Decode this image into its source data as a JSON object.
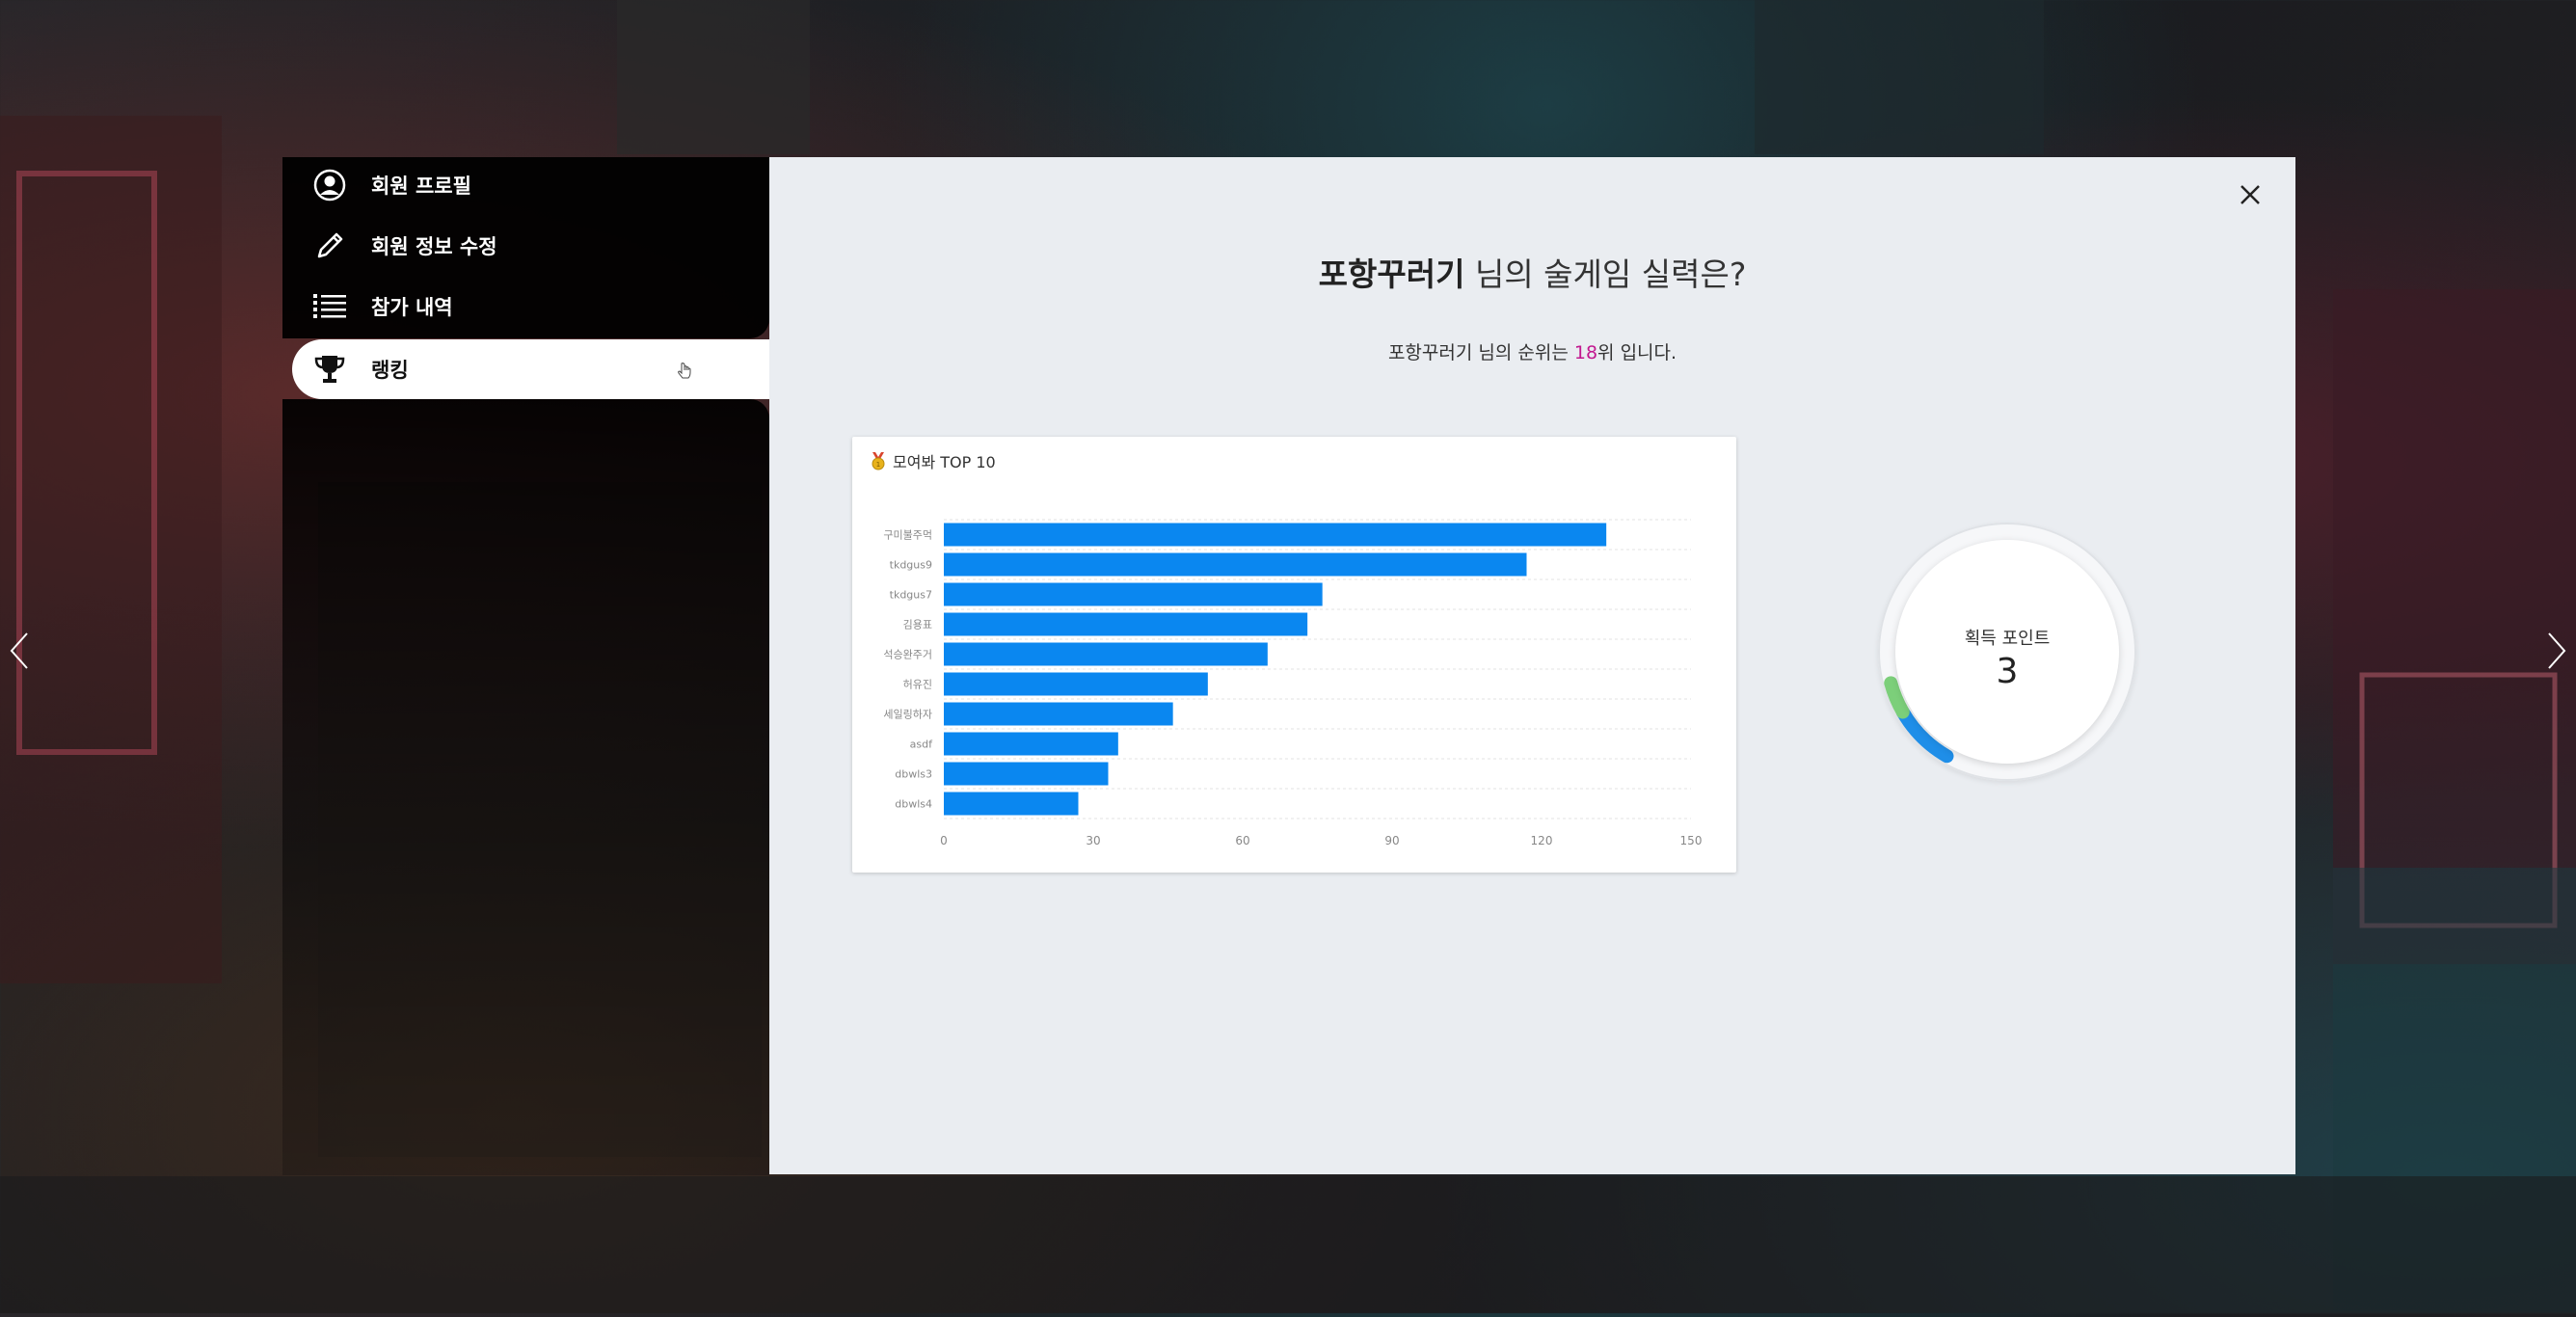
{
  "sidebar": {
    "items": [
      {
        "label": "회원 프로필",
        "icon": "user-circle-icon"
      },
      {
        "label": "회원 정보 수정",
        "icon": "pencil-icon"
      },
      {
        "label": "참가 내역",
        "icon": "list-icon"
      },
      {
        "label": "랭킹",
        "icon": "trophy-icon",
        "active": true
      }
    ]
  },
  "modal": {
    "title_name": "포항꾸러기",
    "title_rest": " 님의 술게임 실력은?",
    "subtitle_pre": "포항꾸러기 님의 순위는 ",
    "subtitle_rank": "18",
    "subtitle_post": "위 입니다.",
    "close_icon": "close-icon"
  },
  "chart_card": {
    "title": "모여봐 TOP 10",
    "icon": "medal-icon"
  },
  "points": {
    "label": "획득 포인트",
    "value": "3",
    "fraction": 0.04
  },
  "colors": {
    "bar": "#0a87f0",
    "rank": "#c2188f",
    "modal_bg": "#eaedf1"
  },
  "chart_data": {
    "type": "bar",
    "orientation": "horizontal",
    "title": "모여봐 TOP 10",
    "categories": [
      "구미불주먹",
      "tkdgus9",
      "tkdgus7",
      "김용표",
      "석승완주거",
      "허유진",
      "세일링하자",
      "asdf",
      "dbwls3",
      "dbwls4"
    ],
    "values": [
      133,
      117,
      76,
      73,
      65,
      53,
      46,
      35,
      33,
      27
    ],
    "xlim": [
      0,
      150
    ],
    "xticks": [
      0,
      30,
      60,
      90,
      120,
      150
    ],
    "grid": true,
    "legend": "none"
  }
}
